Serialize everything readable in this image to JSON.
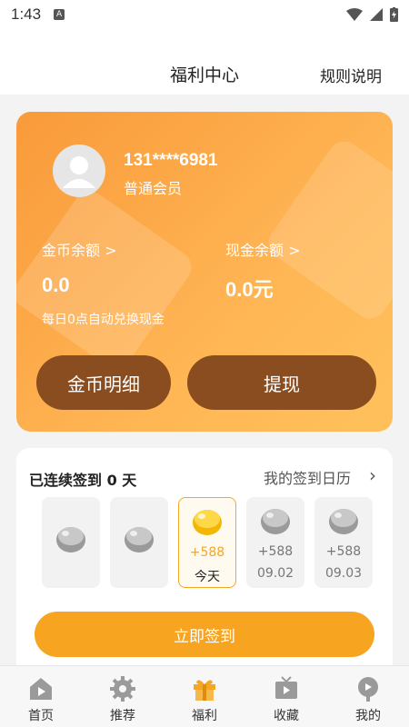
{
  "status": {
    "time": "1:43",
    "badge": "A"
  },
  "header": {
    "title": "福利中心",
    "rules": "规则说明"
  },
  "user": {
    "phone": "131****6981",
    "level": "普通会员"
  },
  "balances": {
    "coin_label": "金币余额 >",
    "coin_value": "0.0",
    "cash_label": "现金余额 >",
    "cash_value": "0.0元",
    "note": "每日0点自动兑换现金"
  },
  "buttons": {
    "coin_detail": "金币明细",
    "withdraw": "提现",
    "sign_now": "立即签到"
  },
  "signin": {
    "streak": "已连续签到 0 天",
    "calendar_link": "我的签到日历",
    "days": [
      {
        "points": "",
        "label": "",
        "state": "past"
      },
      {
        "points": "",
        "label": "",
        "state": "past"
      },
      {
        "points": "+588",
        "label": "今天",
        "state": "today"
      },
      {
        "points": "+588",
        "label": "09.02",
        "state": "future"
      },
      {
        "points": "+588",
        "label": "09.03",
        "state": "future"
      }
    ]
  },
  "tabbar": {
    "items": [
      {
        "label": "首页",
        "icon": "home-play-icon"
      },
      {
        "label": "推荐",
        "icon": "gear-icon"
      },
      {
        "label": "福利",
        "icon": "gift-icon"
      },
      {
        "label": "收藏",
        "icon": "tv-icon"
      },
      {
        "label": "我的",
        "icon": "profile-icon"
      }
    ],
    "active": "福利"
  },
  "colors": {
    "accent": "#f7a421",
    "card_btn": "#8a4d1f",
    "gift": "#f5a623"
  }
}
